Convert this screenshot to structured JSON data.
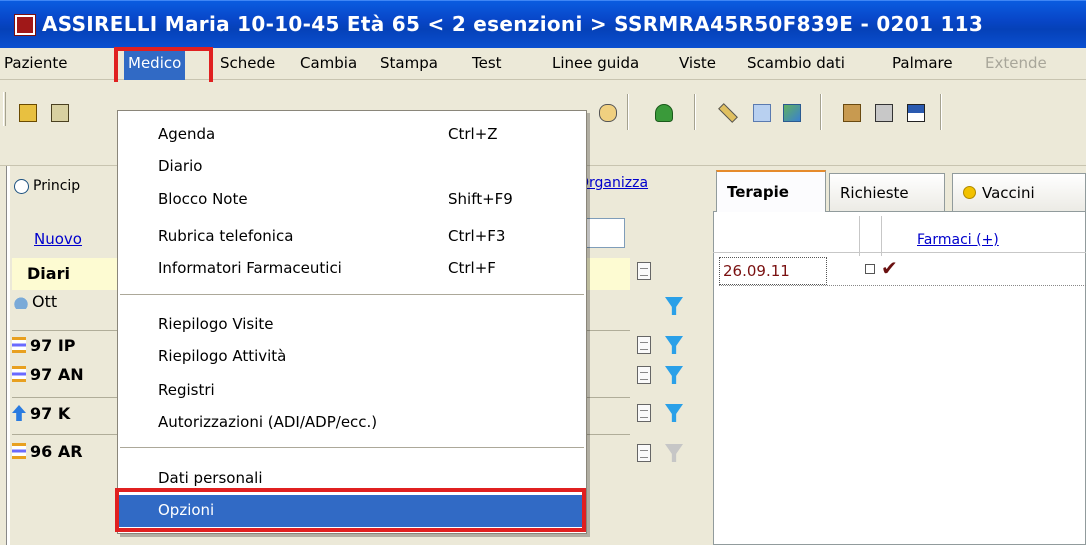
{
  "titlebar": {
    "text": "ASSIRELLI Maria  10-10-45  Età 65  < 2 esenzioni >  SSRMRA45R50F839E - 0201 113"
  },
  "menubar": {
    "items": [
      {
        "label": "Paziente"
      },
      {
        "label": "Medico"
      },
      {
        "label": "Schede"
      },
      {
        "label": "Cambia"
      },
      {
        "label": "Stampa"
      },
      {
        "label": "Test"
      },
      {
        "label": "Linee guida"
      },
      {
        "label": "Viste"
      },
      {
        "label": "Scambio dati"
      },
      {
        "label": "Palmare"
      },
      {
        "label": "Extende"
      }
    ]
  },
  "medico_menu": {
    "items": [
      {
        "label": "Agenda",
        "shortcut": "Ctrl+Z"
      },
      {
        "label": "Diario",
        "shortcut": ""
      },
      {
        "label": "Blocco Note",
        "shortcut": "Shift+F9"
      },
      {
        "label": "Rubrica telefonica",
        "shortcut": "Ctrl+F3"
      },
      {
        "label": "Informatori Farmaceutici",
        "shortcut": "Ctrl+F"
      },
      {
        "label": "Riepilogo Visite",
        "shortcut": ""
      },
      {
        "label": "Riepilogo Attività",
        "shortcut": ""
      },
      {
        "label": "Registri",
        "shortcut": ""
      },
      {
        "label": "Autorizzazioni (ADI/ADP/ecc.)",
        "shortcut": ""
      },
      {
        "label": "Dati personali",
        "shortcut": ""
      },
      {
        "label": "Opzioni",
        "shortcut": ""
      }
    ]
  },
  "left": {
    "radio_label": "Princip",
    "organizza": "Organizza",
    "nuovo": "Nuovo",
    "rows": [
      "Diari",
      "Ott",
      "97 IP",
      "97 AN",
      "97 K",
      "96 AR"
    ]
  },
  "right": {
    "tabs": [
      "Terapie",
      "Richieste",
      "Vaccini"
    ],
    "farmaci": "Farmaci (+)",
    "date": "26.09.11",
    "check": "✔"
  },
  "colors": {
    "title_blue": "#0846c8",
    "menu_select": "#316ac5",
    "highlight_red": "#e02020"
  }
}
